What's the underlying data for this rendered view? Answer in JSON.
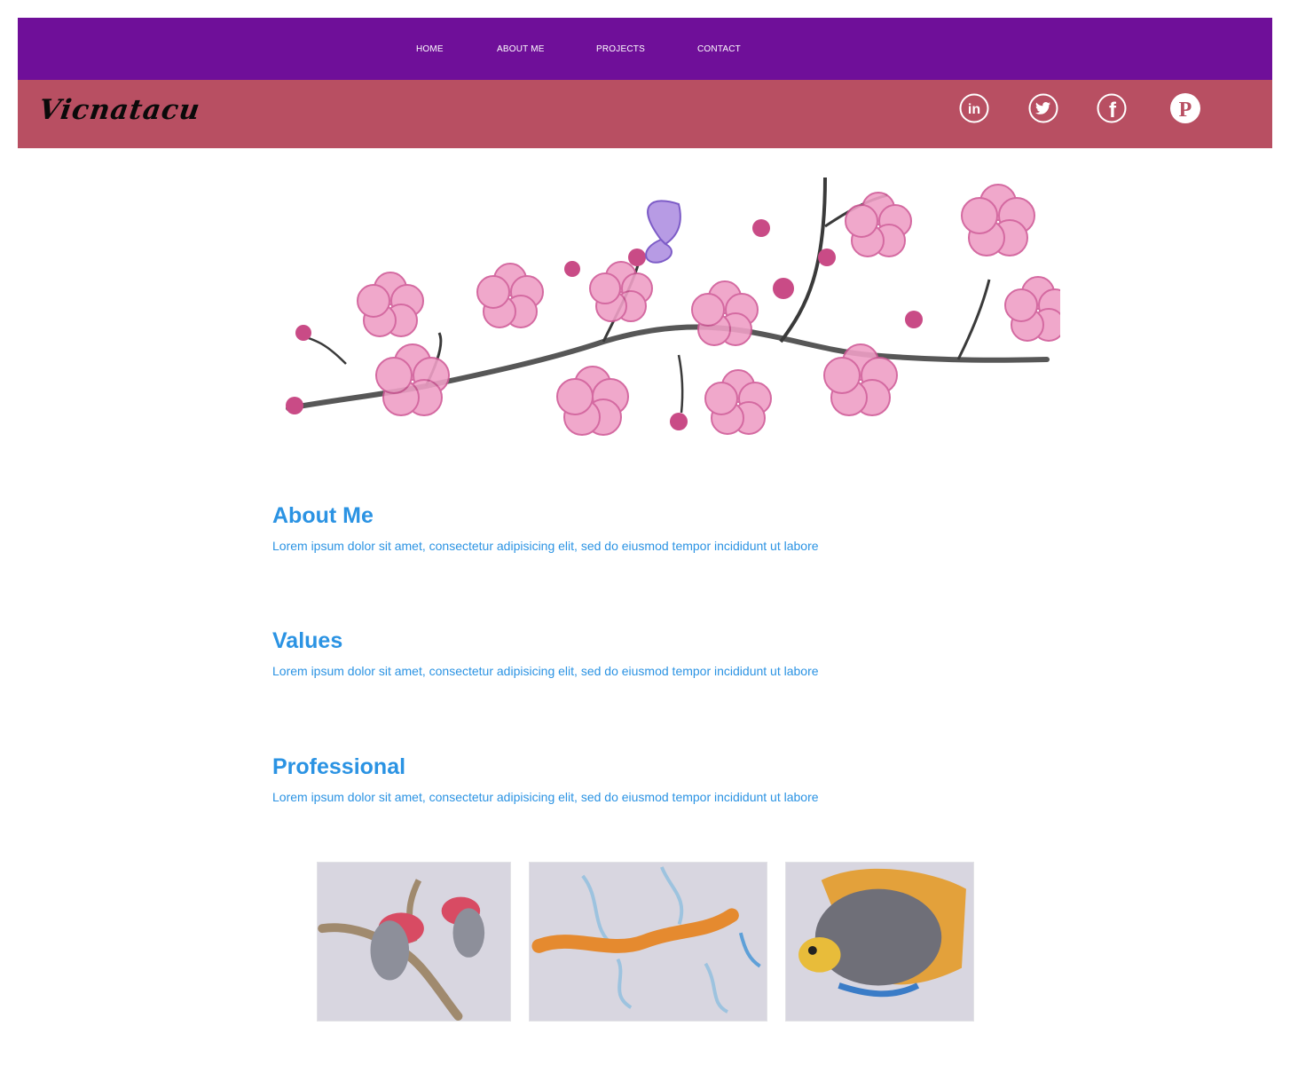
{
  "nav": {
    "items": [
      {
        "label": "HOME"
      },
      {
        "label": "ABOUT ME"
      },
      {
        "label": "PROJECTS"
      },
      {
        "label": "CONTACT"
      }
    ],
    "background": "#6f0f99"
  },
  "banner": {
    "logo": "Vicnatacu",
    "background": "#b84f62",
    "social": [
      {
        "icon": "linkedin-icon",
        "glyph": "in"
      },
      {
        "icon": "twitter-icon"
      },
      {
        "icon": "facebook-icon",
        "glyph": "f"
      },
      {
        "icon": "pinterest-icon",
        "glyph": "P"
      }
    ]
  },
  "hero": {
    "image": "cherry-blossom-branch-drawing-with-butterfly"
  },
  "sections": [
    {
      "title": "About Me",
      "text": "Lorem ipsum dolor sit amet, consectetur adipisicing elit, sed do eiusmod tempor incididunt ut labore"
    },
    {
      "title": "Values",
      "text": "Lorem ipsum dolor sit amet, consectetur adipisicing elit, sed do eiusmod tempor incididunt ut labore"
    },
    {
      "title": "Professional",
      "text": "Lorem ipsum dolor sit amet, consectetur adipisicing elit, sed do eiusmod tempor incididunt ut labore"
    }
  ],
  "gallery": [
    {
      "subject": "two-birds-on-branch-drawing"
    },
    {
      "subject": "leafy-sea-dragon-drawing"
    },
    {
      "subject": "tropical-fish-drawing"
    }
  ],
  "colors": {
    "heading": "#2b93e3",
    "text": "#2b93e3"
  }
}
